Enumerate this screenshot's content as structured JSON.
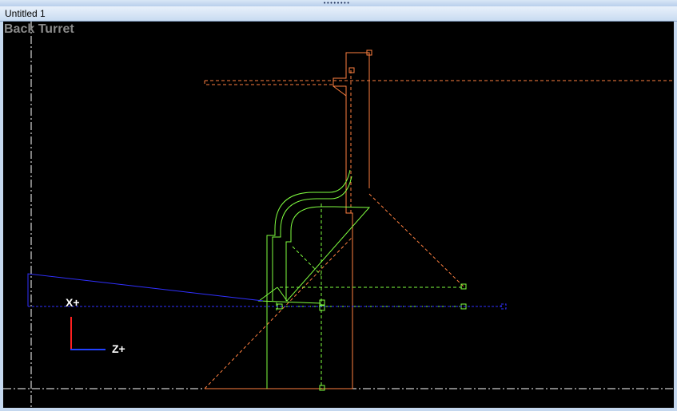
{
  "window": {
    "title": "Untitled 1",
    "grip_glyph": "••••••••",
    "view_label": "Back Turret"
  },
  "axes": {
    "x_label": "X+",
    "z_label": "Z+"
  },
  "colors": {
    "viewport_background": "#000000",
    "part_outline": "#ff8040",
    "toolpath": "#80ff40",
    "tool_line": "#3030ff",
    "centerline": "#ffffff",
    "view_label": "#8a8a8a",
    "x_axis": "#ff2020",
    "z_axis": "#2040ff"
  }
}
